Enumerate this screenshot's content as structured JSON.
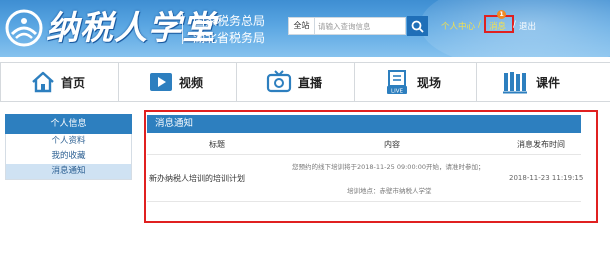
{
  "header": {
    "logo_text": "纳税人学堂",
    "org_line1": "国家税务总局",
    "org_line2": "湖北省税务局",
    "colors": {
      "banner_top": "#3e8ed2",
      "banner_bottom": "#86c2ee",
      "link_yellow": "#f5e04a",
      "highlight_red": "#e02020"
    }
  },
  "search": {
    "scope": "全站",
    "placeholder": "请输入查询信息",
    "button_icon": "search-icon"
  },
  "user_links": {
    "personal_center": "个人中心",
    "separator": "/",
    "messages": "消息",
    "message_badge": "1",
    "logout": "退出"
  },
  "nav": {
    "items": [
      {
        "label": "首页",
        "icon": "home-icon"
      },
      {
        "label": "视频",
        "icon": "video-play-icon"
      },
      {
        "label": "直播",
        "icon": "tv-live-icon"
      },
      {
        "label": "现场",
        "icon": "building-live-icon"
      },
      {
        "label": "课件",
        "icon": "books-icon"
      }
    ]
  },
  "sidebar": {
    "header": "个人信息",
    "items": [
      {
        "label": "个人资料",
        "active": false
      },
      {
        "label": "我的收藏",
        "active": false
      },
      {
        "label": "消息通知",
        "active": true
      }
    ]
  },
  "messages_panel": {
    "title": "消息通知",
    "columns": [
      "标题",
      "内容",
      "消息发布时间"
    ],
    "rows": [
      {
        "title": "新办纳税人培训的培训计划",
        "content_line1": "您预约的线下培训将于2018-11-25 09:00:00开始，请准时参加；",
        "content_line2": "培训地点：赤壁市纳税人学堂",
        "time": "2018-11-23 11:19:15"
      }
    ]
  }
}
